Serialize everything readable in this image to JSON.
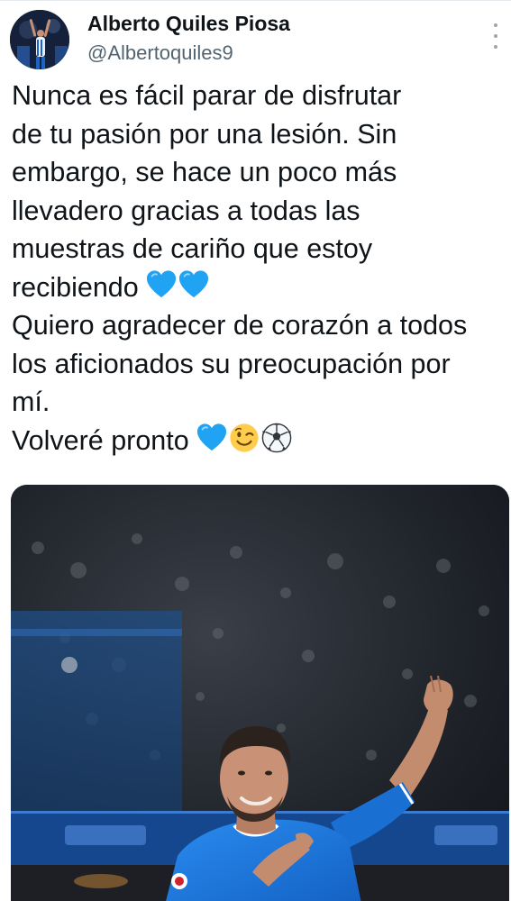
{
  "author": {
    "name": "Alberto Quiles Piosa",
    "handle": "@Albertoquiles9"
  },
  "icons": {
    "more": "more-vertical-icon",
    "blue_heart": "blue-heart-emoji",
    "wink": "winking-face-emoji",
    "soccer": "soccer-ball-emoji"
  },
  "tweet": {
    "lines": [
      "Nunca es fácil parar de disfrutar",
      "de tu pasión por una lesión. Sin",
      "embargo, se hace un poco más",
      "llevadero gracias a todas las",
      "muestras de cariño que estoy",
      "recibiendo",
      "Quiero agradecer de corazón a todos",
      "los aficionados su preocupación por",
      "mí.",
      "Volveré pronto"
    ]
  },
  "colors": {
    "text": "#0f1419",
    "secondary": "#536471",
    "heart_blue": "#1fa3f2",
    "kit_blue": "#1877d6"
  }
}
